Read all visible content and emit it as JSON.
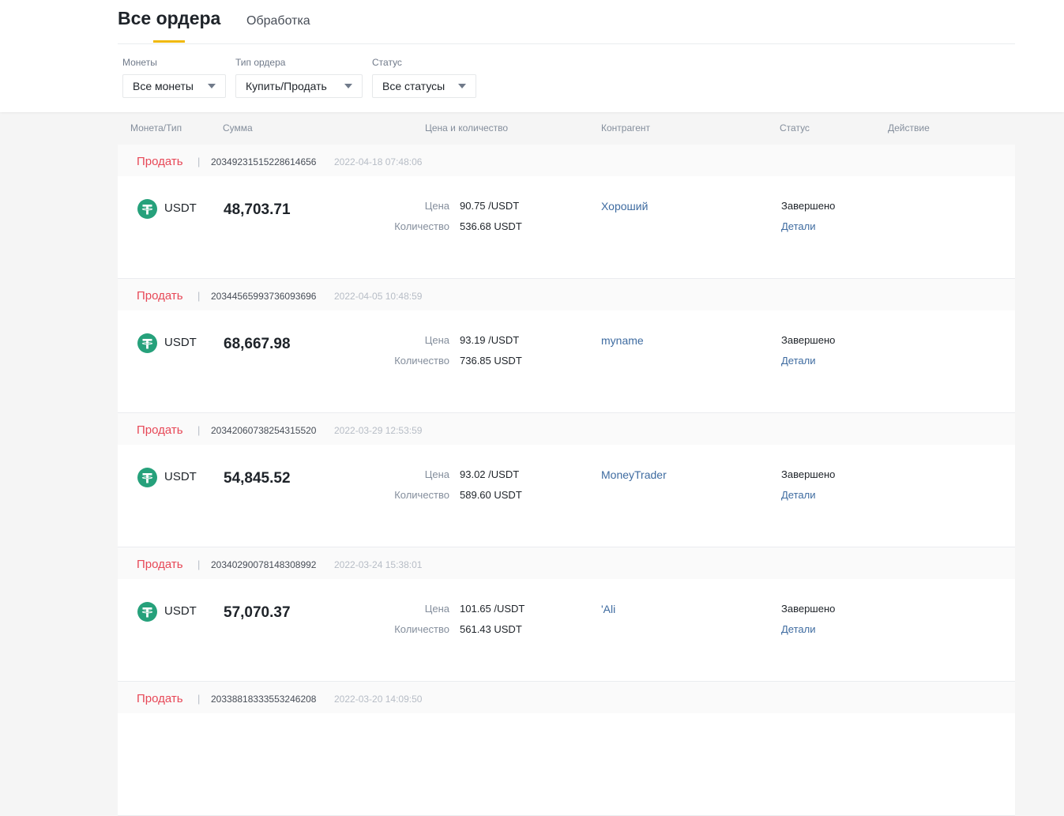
{
  "tabs": {
    "all_orders": "Все ордера",
    "processing": "Обработка"
  },
  "filters": {
    "coins": {
      "label": "Монеты",
      "value": "Все монеты"
    },
    "order_type": {
      "label": "Тип ордера",
      "value": "Купить/Продать"
    },
    "status": {
      "label": "Статус",
      "value": "Все статусы"
    }
  },
  "columns": {
    "coin_type": "Монета/Тип",
    "amount": "Сумма",
    "price_qty": "Цена и количество",
    "counterparty": "Контрагент",
    "status": "Статус",
    "action": "Действие"
  },
  "labels": {
    "price": "Цена",
    "quantity": "Количество"
  },
  "orders": [
    {
      "side": "Продать",
      "id": "20349231515228614656",
      "time": "2022-04-18 07:48:06",
      "coin": "USDT",
      "amount": "48,703.71",
      "price": "90.75 /USDT",
      "quantity": "536.68 USDT",
      "counterparty": "Хороший",
      "status": "Завершено",
      "details": "Детали"
    },
    {
      "side": "Продать",
      "id": "20344565993736093696",
      "time": "2022-04-05 10:48:59",
      "coin": "USDT",
      "amount": "68,667.98",
      "price": "93.19 /USDT",
      "quantity": "736.85 USDT",
      "counterparty": "myname",
      "status": "Завершено",
      "details": "Детали"
    },
    {
      "side": "Продать",
      "id": "20342060738254315520",
      "time": "2022-03-29 12:53:59",
      "coin": "USDT",
      "amount": "54,845.52",
      "price": "93.02 /USDT",
      "quantity": "589.60 USDT",
      "counterparty": "MoneyTrader",
      "status": "Завершено",
      "details": "Детали"
    },
    {
      "side": "Продать",
      "id": "20340290078148308992",
      "time": "2022-03-24 15:38:01",
      "coin": "USDT",
      "amount": "57,070.37",
      "price": "101.65 /USDT",
      "quantity": "561.43 USDT",
      "counterparty": "'Ali",
      "status": "Завершено",
      "details": "Детали"
    },
    {
      "side": "Продать",
      "id": "20338818333553246208",
      "time": "2022-03-20 14:09:50"
    }
  ],
  "colors": {
    "accent": "#f0b90b",
    "sell": "#e74857",
    "link": "#3e6ba0",
    "usdt": "#26a17b"
  }
}
